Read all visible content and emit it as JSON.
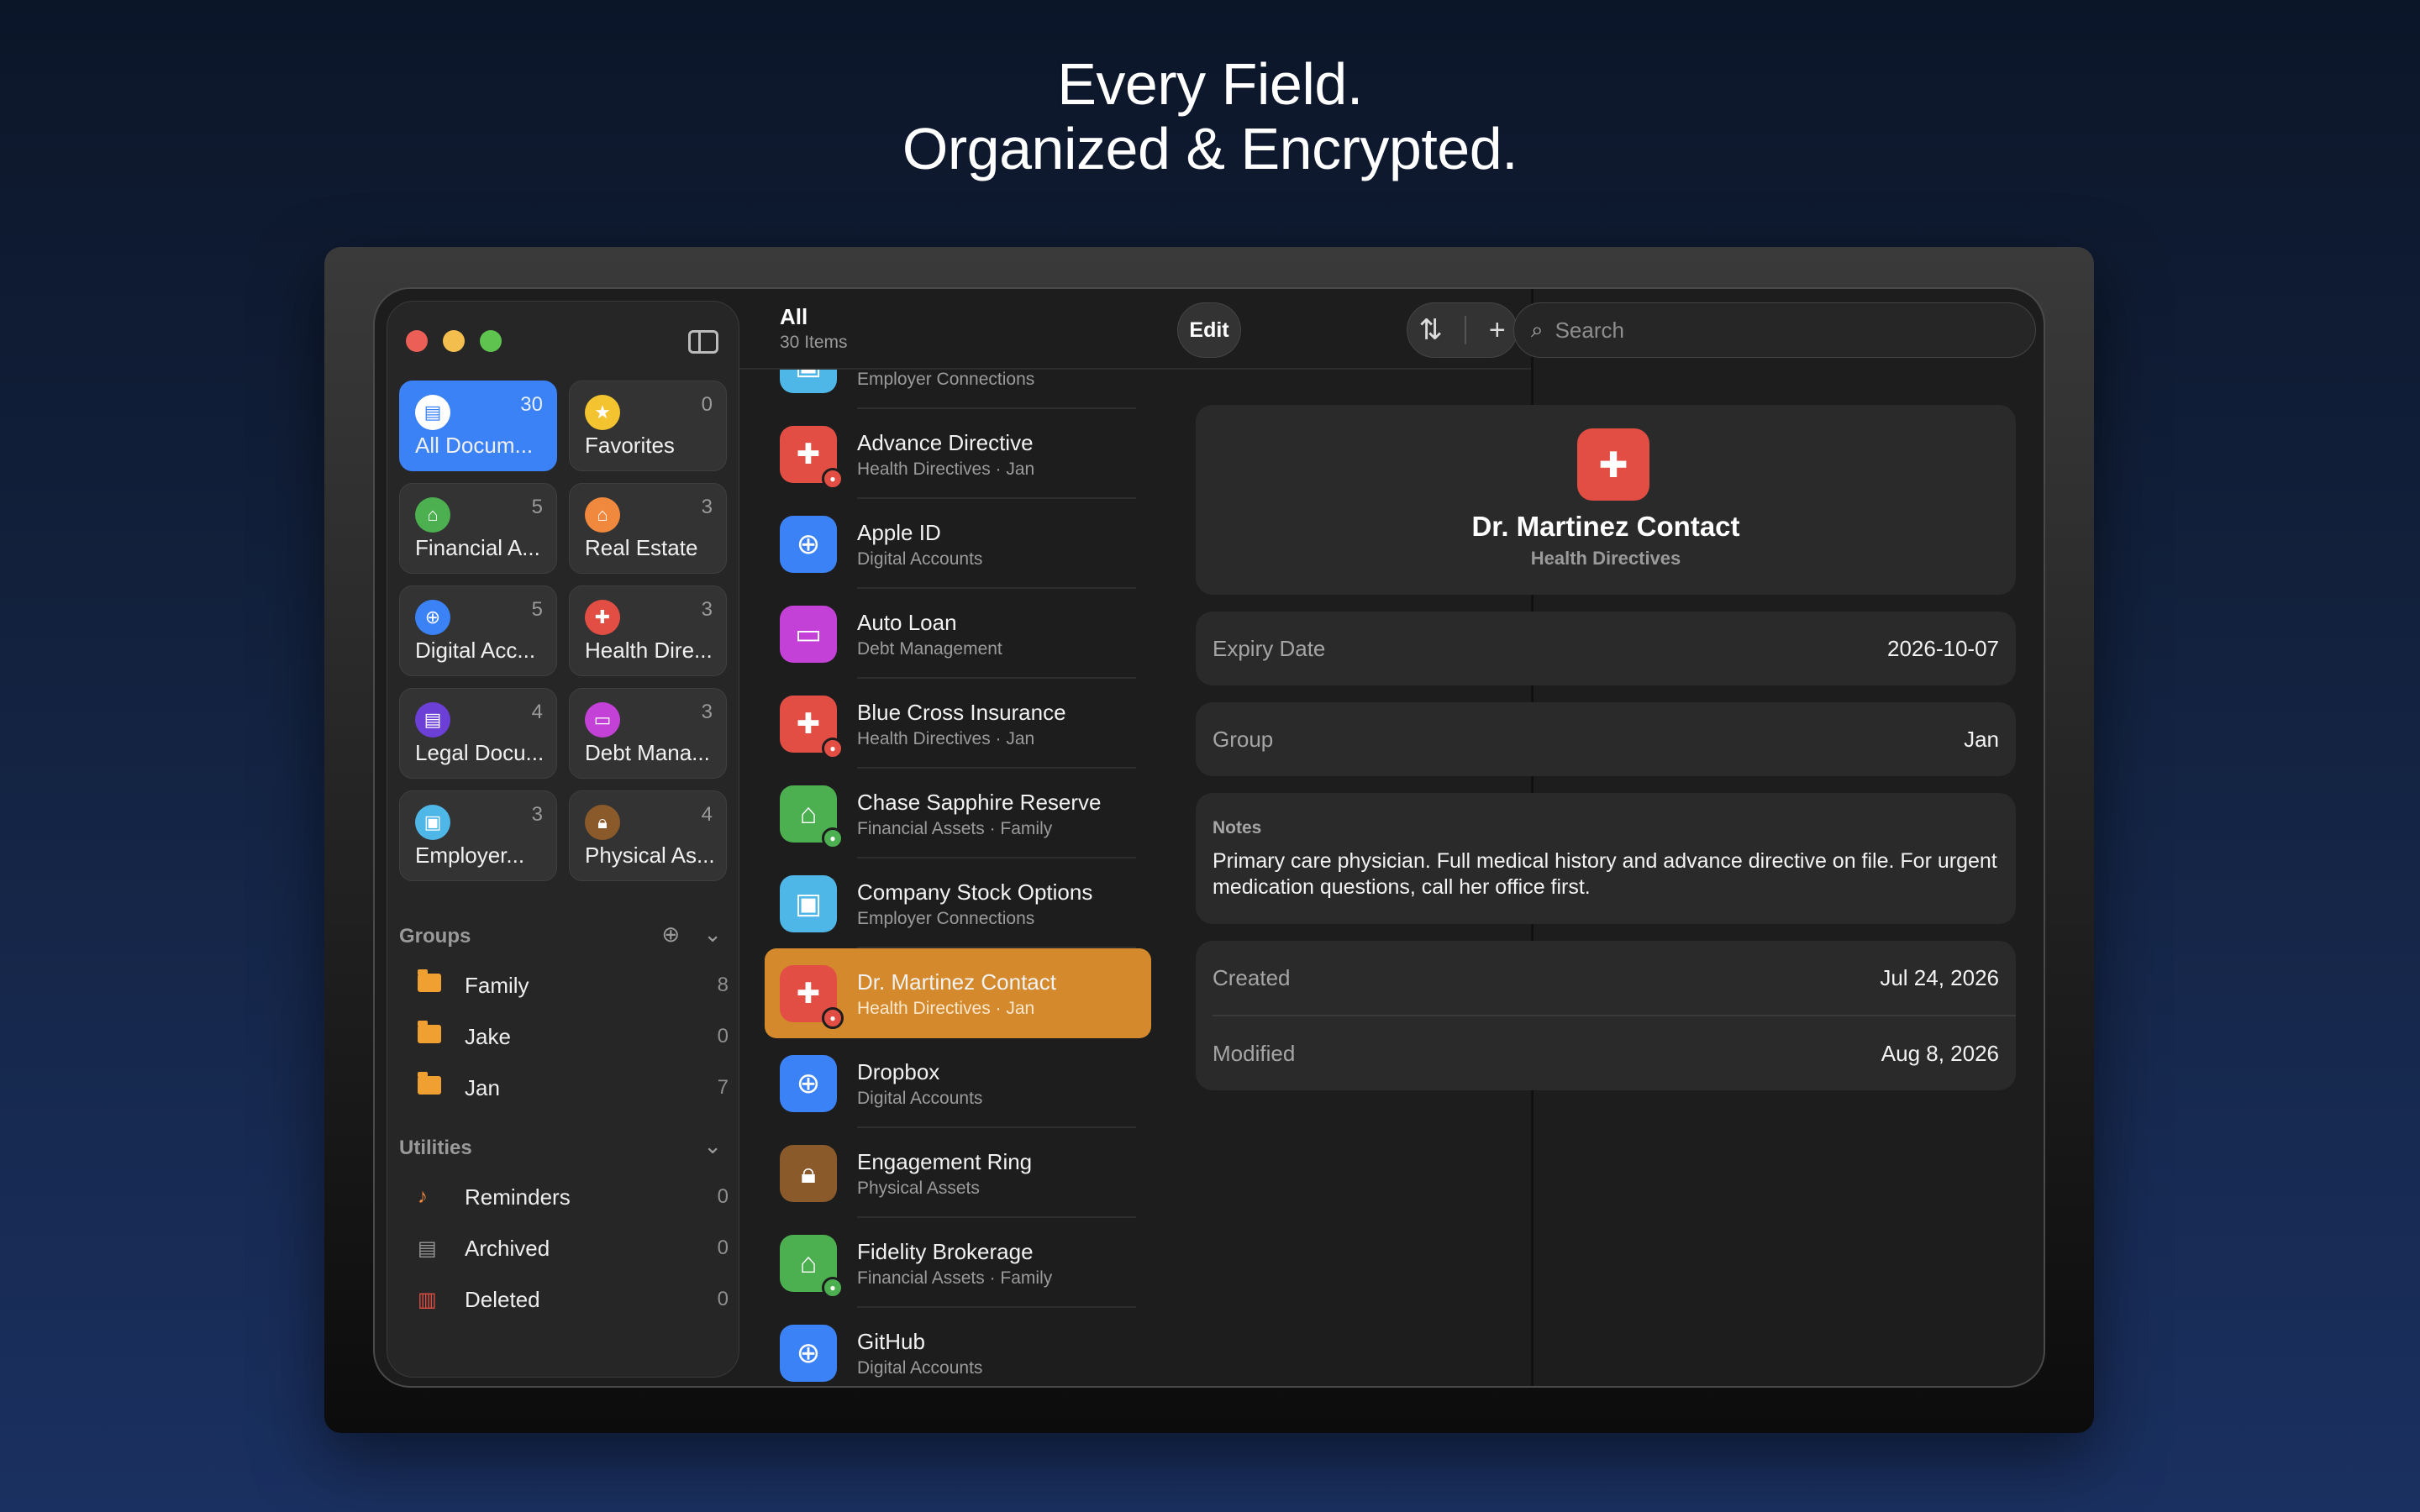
{
  "headline": {
    "line1": "Every Field.",
    "line2": "Organized & Encrypted."
  },
  "categories": [
    {
      "label": "All Docum...",
      "count": "30",
      "color": "#ffffff",
      "icon": "document-icon"
    },
    {
      "label": "Favorites",
      "count": "0",
      "color": "#f4c430",
      "icon": "star-icon"
    },
    {
      "label": "Financial A...",
      "count": "5",
      "color": "#4caf50",
      "icon": "bank-icon"
    },
    {
      "label": "Real Estate",
      "count": "3",
      "color": "#f0883e",
      "icon": "house-icon"
    },
    {
      "label": "Digital Acc...",
      "count": "5",
      "color": "#3b82f6",
      "icon": "globe-icon"
    },
    {
      "label": "Health Dire...",
      "count": "3",
      "color": "#e34e44",
      "icon": "medkit-icon"
    },
    {
      "label": "Legal Docu...",
      "count": "4",
      "color": "#6c3fd6",
      "icon": "document-icon"
    },
    {
      "label": "Debt Mana...",
      "count": "3",
      "color": "#c341d6",
      "icon": "credit-card-icon"
    },
    {
      "label": "Employer...",
      "count": "3",
      "color": "#4fb7e8",
      "icon": "briefcase-icon"
    },
    {
      "label": "Physical As...",
      "count": "4",
      "color": "#8b5a2b",
      "icon": "lock-icon"
    }
  ],
  "groups": {
    "title": "Groups",
    "items": [
      {
        "label": "Family",
        "count": "8"
      },
      {
        "label": "Jake",
        "count": "0"
      },
      {
        "label": "Jan",
        "count": "7"
      }
    ]
  },
  "utilities": {
    "title": "Utilities",
    "items": [
      {
        "label": "Reminders",
        "count": "0",
        "icon": "bell-icon",
        "color": "#f0883e"
      },
      {
        "label": "Archived",
        "count": "0",
        "icon": "archive-icon",
        "color": "#9a9a9a"
      },
      {
        "label": "Deleted",
        "count": "0",
        "icon": "trash-icon",
        "color": "#e34e44"
      }
    ]
  },
  "list": {
    "title": "All",
    "subtitle": "30 Items",
    "items": [
      {
        "name": "",
        "sub": "Employer Connections",
        "color": "#4fb7e8",
        "icon": "briefcase-icon",
        "badge": ""
      },
      {
        "name": "Advance Directive",
        "sub": "Health Directives · Jan",
        "color": "#e34e44",
        "icon": "medkit-icon",
        "badge": "#e34e44"
      },
      {
        "name": "Apple ID",
        "sub": "Digital Accounts",
        "color": "#3b82f6",
        "icon": "globe-icon",
        "badge": ""
      },
      {
        "name": "Auto Loan",
        "sub": "Debt Management",
        "color": "#c341d6",
        "icon": "credit-card-icon",
        "badge": ""
      },
      {
        "name": "Blue Cross Insurance",
        "sub": "Health Directives · Jan",
        "color": "#e34e44",
        "icon": "medkit-icon",
        "badge": "#e34e44"
      },
      {
        "name": "Chase Sapphire Reserve",
        "sub": "Financial Assets · Family",
        "color": "#4caf50",
        "icon": "bank-icon",
        "badge": "#4caf50"
      },
      {
        "name": "Company Stock Options",
        "sub": "Employer Connections",
        "color": "#4fb7e8",
        "icon": "briefcase-icon",
        "badge": ""
      },
      {
        "name": "Dr. Martinez Contact",
        "sub": "Health Directives · Jan",
        "color": "#e34e44",
        "icon": "medkit-icon",
        "badge": "#e34e44",
        "selected": true
      },
      {
        "name": "Dropbox",
        "sub": "Digital Accounts",
        "color": "#3b82f6",
        "icon": "globe-icon",
        "badge": ""
      },
      {
        "name": "Engagement Ring",
        "sub": "Physical Assets",
        "color": "#8b5a2b",
        "icon": "lock-icon",
        "badge": ""
      },
      {
        "name": "Fidelity Brokerage",
        "sub": "Financial Assets · Family",
        "color": "#4caf50",
        "icon": "bank-icon",
        "badge": "#4caf50"
      },
      {
        "name": "GitHub",
        "sub": "Digital Accounts",
        "color": "#3b82f6",
        "icon": "globe-icon",
        "badge": ""
      }
    ]
  },
  "detail": {
    "edit_label": "Edit",
    "search_placeholder": "Search",
    "title": "Dr. Martinez Contact",
    "category": "Health Directives",
    "expiry_label": "Expiry Date",
    "expiry_value": "2026-10-07",
    "group_label": "Group",
    "group_value": "Jan",
    "notes_label": "Notes",
    "notes_text": "Primary care physician. Full medical history and advance directive on file. For urgent medication questions, call her office first.",
    "created_label": "Created",
    "created_value": "Jul 24, 2026",
    "modified_label": "Modified",
    "modified_value": "Aug 8, 2026"
  }
}
